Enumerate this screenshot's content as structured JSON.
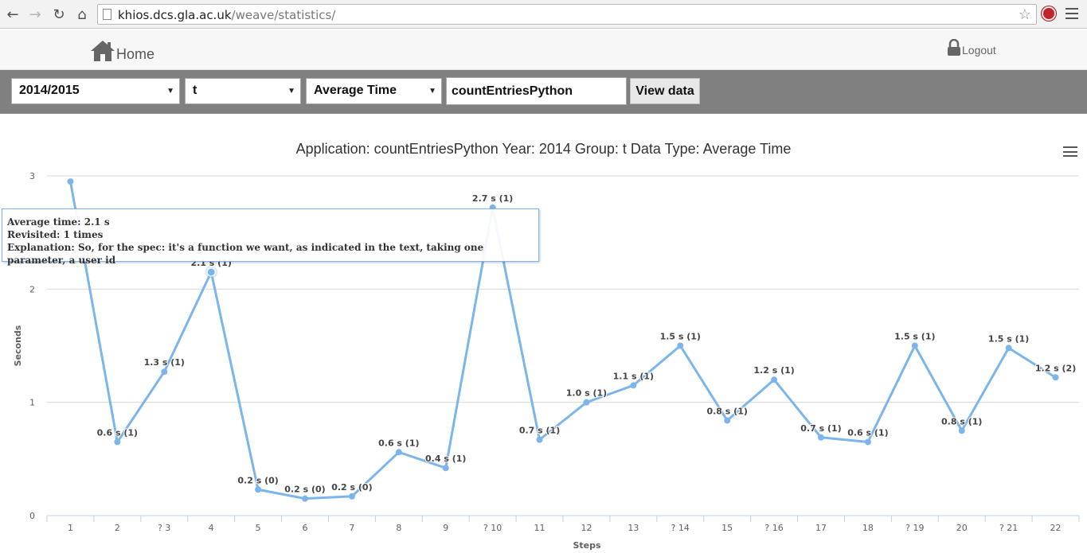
{
  "browser": {
    "url_host": "khios.dcs.gla.ac.uk",
    "url_path": "/weave/statistics/"
  },
  "header": {
    "home_label": "Home",
    "logout_label": "Logout"
  },
  "filters": {
    "year": "2014/2015",
    "group": "t",
    "data_type": "Average Time",
    "application": "countEntriesPython",
    "view_button": "View data"
  },
  "tooltip": {
    "line1": "Average time: 2.1 s",
    "line2": "Revisited: 1 times",
    "line3": "Explanation: So, for the spec: it's a function we want, as indicated in the text, taking one parameter, a user id"
  },
  "colors": {
    "series": "#7cb5ec",
    "filter_bar": "#808080"
  },
  "chart_data": {
    "type": "line",
    "title": "Application: countEntriesPython Year: 2014 Group: t Data Type: Average Time",
    "xlabel": "Steps",
    "ylabel": "Seconds",
    "ylim": [
      0,
      3
    ],
    "yticks": [
      "0",
      "1",
      "2",
      "3"
    ],
    "grid": true,
    "categories": [
      "1",
      "2",
      "? 3",
      "4",
      "5",
      "6",
      "7",
      "8",
      "9",
      "? 10",
      "11",
      "12",
      "13",
      "? 14",
      "15",
      "? 16",
      "17",
      "18",
      "? 19",
      "20",
      "? 21",
      "22"
    ],
    "values": [
      2.95,
      0.65,
      1.27,
      2.15,
      0.23,
      0.15,
      0.17,
      0.56,
      0.42,
      2.72,
      0.67,
      1.0,
      1.15,
      1.5,
      0.84,
      1.2,
      0.69,
      0.65,
      1.5,
      0.75,
      1.48,
      1.22
    ],
    "labels": [
      "",
      "0.6 s (1)",
      "1.3 s (1)",
      "2.1 s (1)",
      "0.2 s (0)",
      "0.2 s (0)",
      "0.2 s (0)",
      "0.6 s (1)",
      "0.4 s (1)",
      "2.7 s (1)",
      "0.7 s (1)",
      "1.0 s (1)",
      "1.1 s (1)",
      "1.5 s (1)",
      "0.8 s (1)",
      "1.2 s (1)",
      "0.7 s (1)",
      "0.6 s (1)",
      "1.5 s (1)",
      "0.8 s (1)",
      "1.5 s (1)",
      "1.2 s (2)"
    ],
    "highlighted_index": 3
  }
}
